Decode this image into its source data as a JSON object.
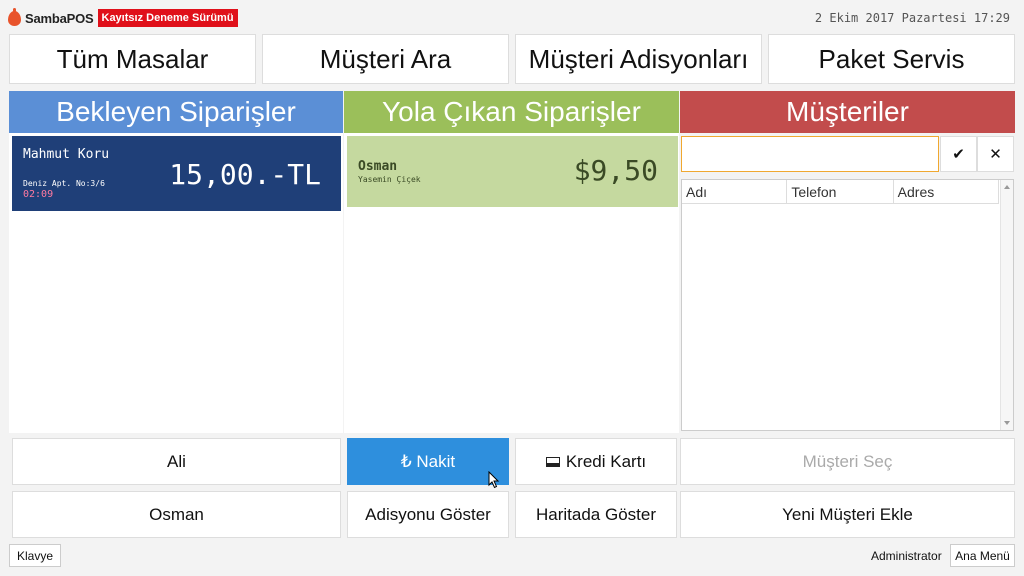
{
  "app": {
    "logo_text": "SambaPOS",
    "trial_badge": "Kayıtsız Deneme Sürümü",
    "datetime": "2 Ekim 2017 Pazartesi 17:29"
  },
  "nav": {
    "all_tables": "Tüm Masalar",
    "customer_search": "Müşteri Ara",
    "customer_tickets": "Müşteri Adisyonları",
    "delivery": "Paket Servis"
  },
  "columns": {
    "pending": {
      "title": "Bekleyen Siparişler",
      "color": "#5b8fd6"
    },
    "on_the_way": {
      "title": "Yola Çıkan Siparişler",
      "color": "#9bbf5a"
    },
    "customers": {
      "title": "Müşteriler",
      "color": "#c24c4c"
    }
  },
  "pending_orders": [
    {
      "name": "Mahmut Koru",
      "address": "Deniz Apt. No:3/6",
      "time": "02:09",
      "amount": "15,00.-TL"
    }
  ],
  "on_the_way_orders": [
    {
      "name": "Osman",
      "driver": "Yasemin Çiçek",
      "amount": "$9,50"
    }
  ],
  "customer_search": {
    "value": "",
    "placeholder": "",
    "confirm_icon": "✔",
    "clear_icon": "✕"
  },
  "grid": {
    "columns": [
      "Adı",
      "Telefon",
      "Adres"
    ]
  },
  "actions": {
    "driver_ali": "Ali",
    "driver_osman": "Osman",
    "cash": "₺ Nakit",
    "credit_card": "Kredi Kartı",
    "show_ticket": "Adisyonu Göster",
    "show_on_map": "Haritada Göster",
    "select_customer": "Müşteri Seç",
    "new_customer": "Yeni Müşteri Ekle"
  },
  "footer": {
    "keyboard": "Klavye",
    "user": "Administrator",
    "main_menu": "Ana Menü"
  }
}
